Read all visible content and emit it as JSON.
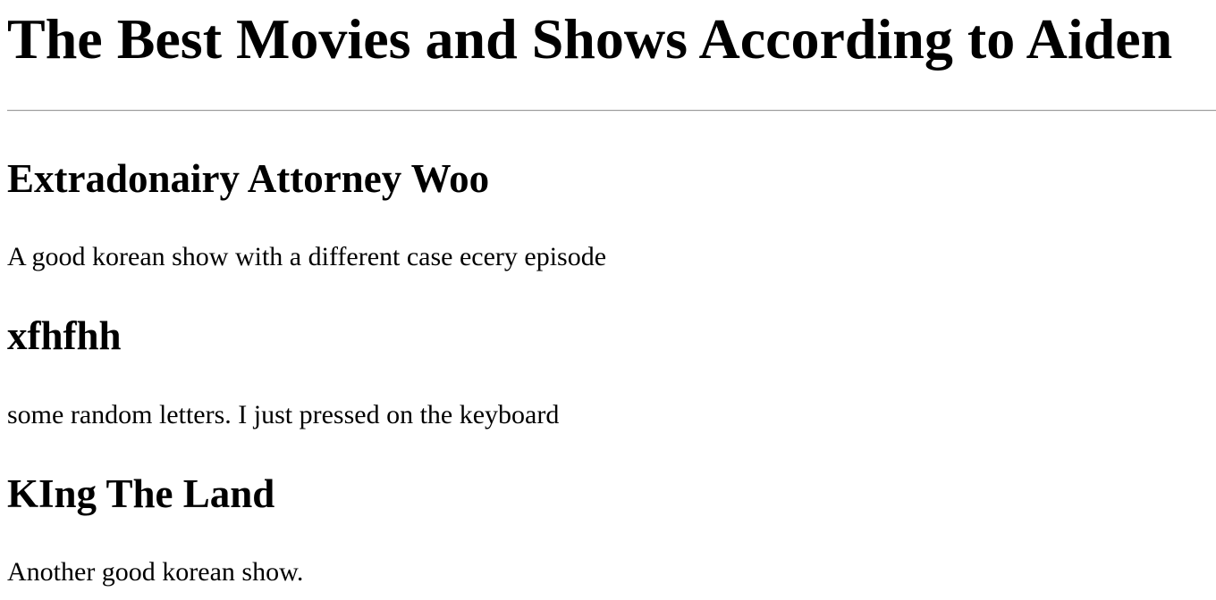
{
  "page": {
    "title": "The Best Movies and Shows According to Aiden"
  },
  "entries": [
    {
      "title": "Extradonairy Attorney Woo",
      "description": "A good korean show with a different case ecery episode"
    },
    {
      "title": "xfhfhh",
      "description": "some random letters. I just pressed on the keyboard"
    },
    {
      "title": "KIng The Land",
      "description": "Another good korean show."
    }
  ]
}
